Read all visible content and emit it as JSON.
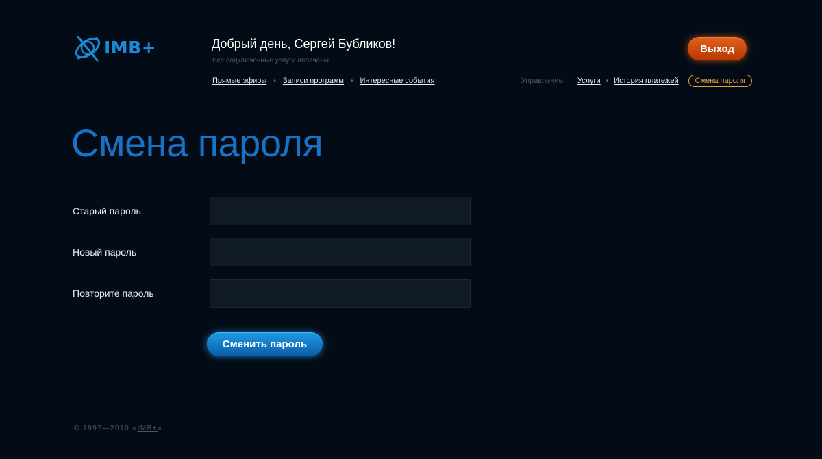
{
  "brand": {
    "logo_text": "IMB+",
    "accent_color": "#1a8ad8"
  },
  "header": {
    "greeting": "Добрый день, Сергей Бубликов!",
    "subgreeting": "Все подключенные услуги оплачены",
    "logout_label": "Выход",
    "nav_main": [
      {
        "label": "Прямые эфиры"
      },
      {
        "label": "Записи программ"
      },
      {
        "label": "Интересные события"
      }
    ],
    "manage_label": "Управление:",
    "nav_manage": [
      {
        "label": "Услуги"
      },
      {
        "label": "История платежей"
      },
      {
        "label": "Смена пароля",
        "active": true
      }
    ]
  },
  "main": {
    "title": "Смена пароля",
    "form": {
      "old_password_label": "Старый пароль",
      "new_password_label": "Новый пароль",
      "repeat_password_label": "Повторите пароль",
      "old_password_value": "",
      "new_password_value": "",
      "repeat_password_value": "",
      "submit_label": "Сменить пароль"
    }
  },
  "footer": {
    "copyright_prefix": "© 1997—2010 «",
    "brand_link": "IMB+",
    "copyright_suffix": "»"
  },
  "colors": {
    "background": "#030c16",
    "title_blue": "#1a72c6",
    "logout_orange": "#c9480e",
    "active_tab_border": "#e9a02a",
    "submit_blue": "#1583d2"
  },
  "icons": {
    "logo_icon": "orbit-satellite-icon",
    "separator_icon": "dot-bullet-icon"
  }
}
